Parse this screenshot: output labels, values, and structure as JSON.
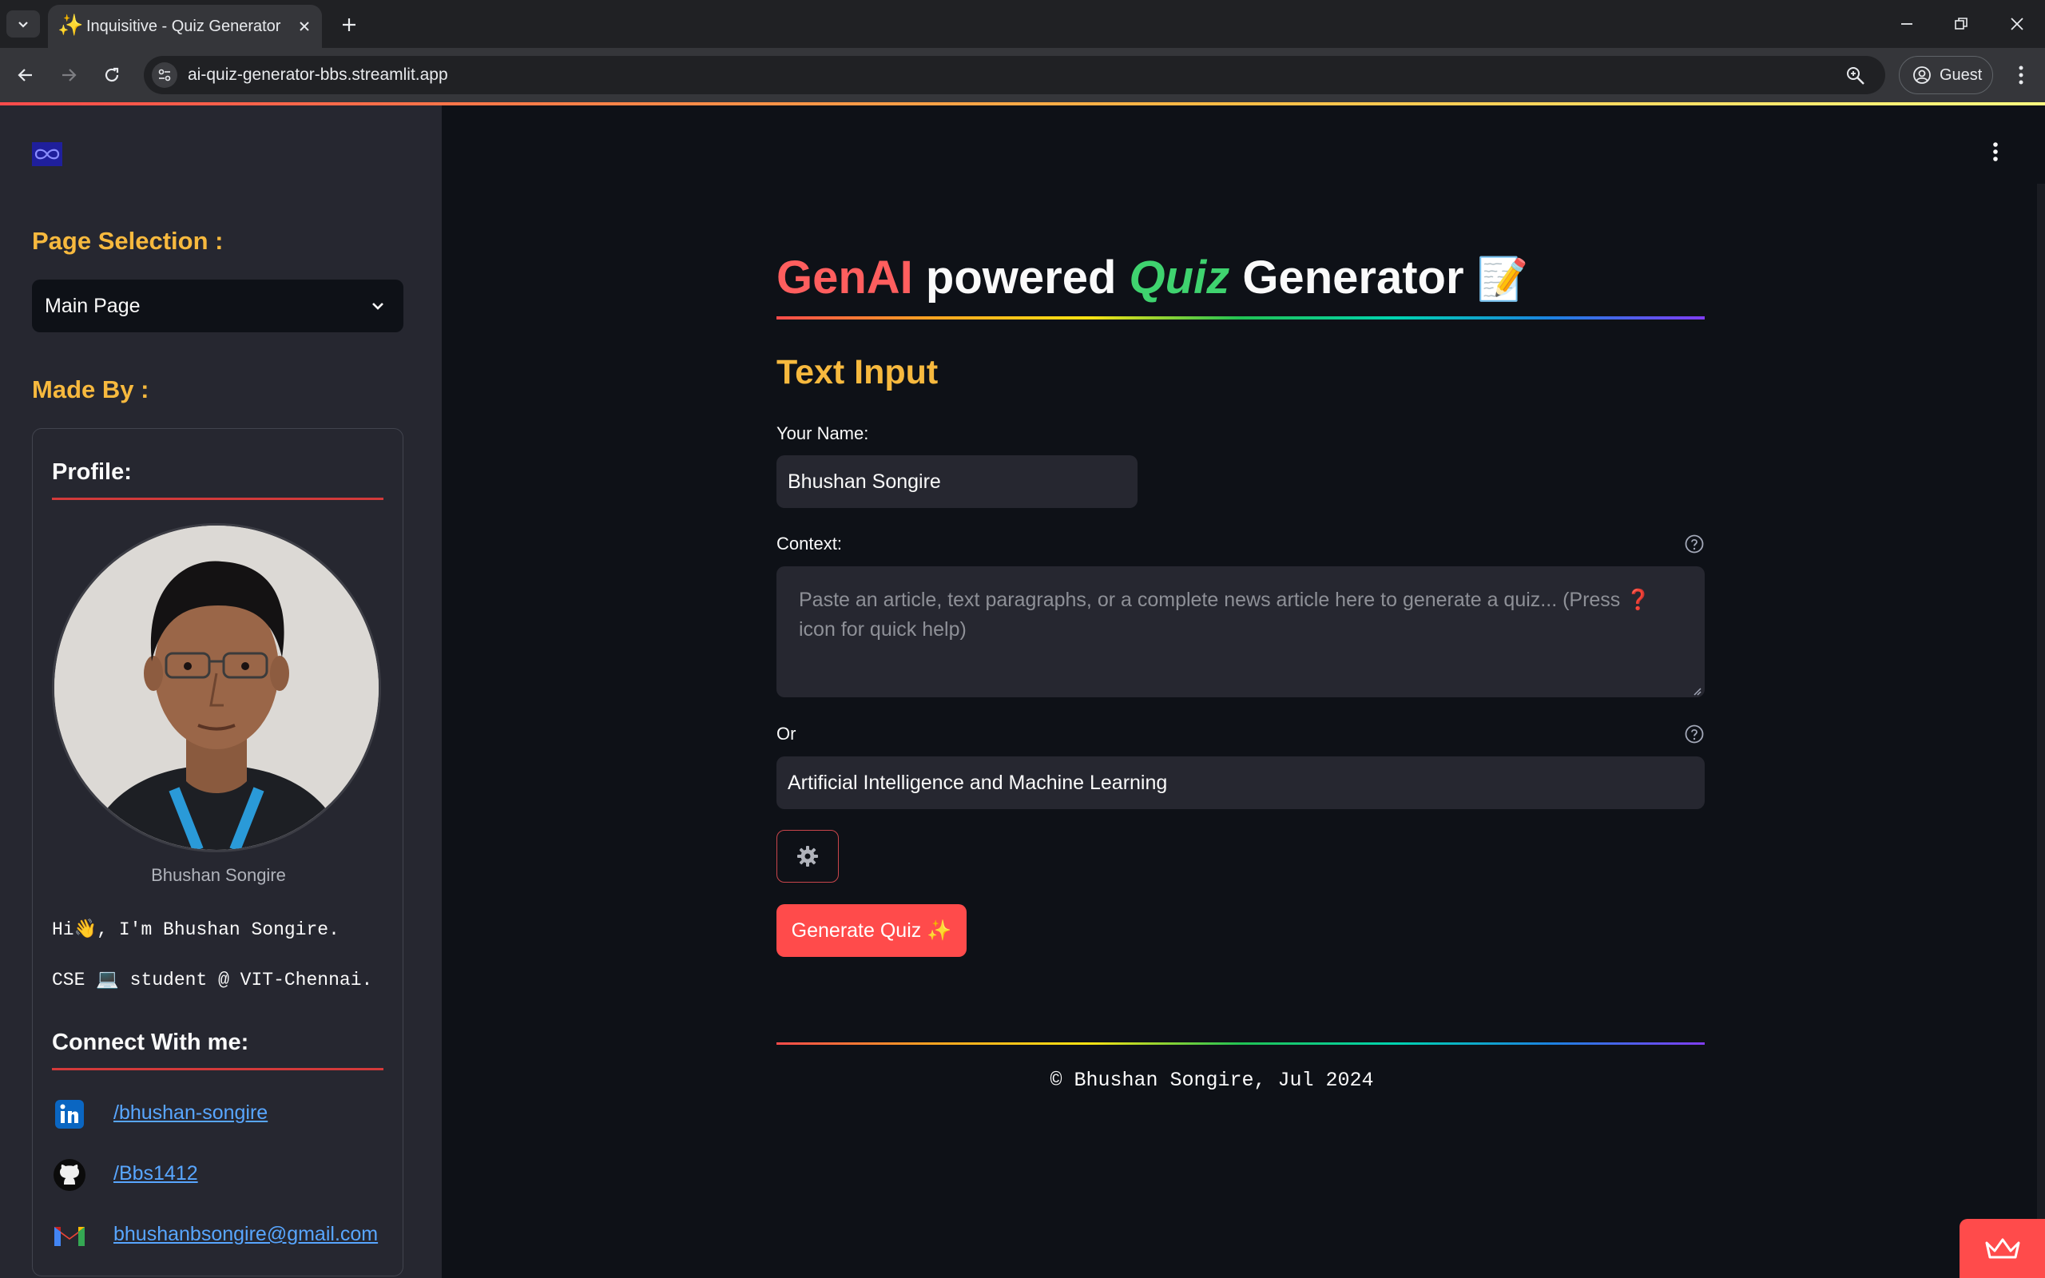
{
  "browser": {
    "tab_title": "Inquisitive - Quiz Generator · Streamlit",
    "url": "ai-quiz-generator-bbs.streamlit.app",
    "profile_label": "Guest"
  },
  "sidebar": {
    "page_selection_label": "Page Selection :",
    "page_select_value": "Main Page",
    "made_by_label": "Made By :",
    "profile_heading": "Profile:",
    "avatar_caption": "Bhushan Songire",
    "bio_line_1": "Hi👋, I'm Bhushan Songire.",
    "bio_line_2": "CSE 💻 student @ VIT-Chennai.",
    "connect_heading": "Connect With me:",
    "links": {
      "linkedin": "/bhushan-songire",
      "github": "/Bbs1412",
      "email": "bhushanbsongire@gmail.com"
    }
  },
  "main": {
    "title_genai": "GenAI",
    "title_powered": " powered ",
    "title_quiz": "Quiz",
    "title_generator": " Generator",
    "title_emoji": "📝",
    "section_heading": "Text Input",
    "name_label": "Your Name:",
    "name_value": "Bhushan Songire",
    "context_label": "Context:",
    "context_placeholder": "Paste an article, text paragraphs, or a complete news article here to generate a quiz... (Press ❓ icon for quick help)",
    "or_label": "Or",
    "topic_value": "Artificial Intelligence and Machine Learning",
    "generate_button": "Generate Quiz ✨",
    "footer": "© Bhushan Songire, Jul 2024"
  },
  "icons": {
    "favicon": "sparkles-icon",
    "settings": "gear-icon",
    "help": "question-circle-icon"
  },
  "colors": {
    "accent": "#ff4b4b",
    "heading_yellow": "#f7b93e",
    "quiz_green": "#3fd36f",
    "link_blue": "#58a6ff"
  }
}
